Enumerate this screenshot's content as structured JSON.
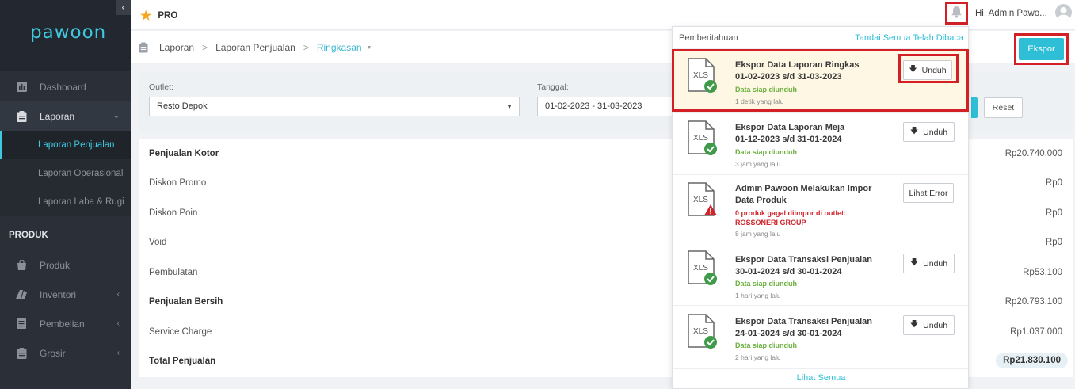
{
  "sidebar": {
    "collapse_glyph": "‹",
    "logo": "pawoon",
    "items": [
      {
        "label": "Dashboard",
        "icon": "bar-chart-icon"
      },
      {
        "label": "Laporan",
        "icon": "clipboard-icon"
      }
    ],
    "sub_items": [
      {
        "label": "Laporan Penjualan",
        "active": true
      },
      {
        "label": "Laporan Operasional"
      },
      {
        "label": "Laporan Laba & Rugi"
      }
    ],
    "section": "PRODUK",
    "product_items": [
      {
        "label": "Produk",
        "icon": "bag-icon"
      },
      {
        "label": "Inventori",
        "icon": "inventory-icon"
      },
      {
        "label": "Pembelian",
        "icon": "document-icon"
      },
      {
        "label": "Grosir",
        "icon": "clipboard-icon"
      }
    ]
  },
  "topbar": {
    "plan": "PRO",
    "greeting": "Hi, Admin Pawo..."
  },
  "breadcrumb": {
    "items": [
      "Laporan",
      "Laporan Penjualan",
      "Ringkasan"
    ],
    "separator": ">"
  },
  "export_label": "Ekspor",
  "filters": {
    "outlet_label": "Outlet:",
    "outlet_value": "Resto Depok",
    "date_label": "Tanggal:",
    "date_value": "01-02-2023 - 31-03-2023",
    "reset_label": "Reset"
  },
  "summary": [
    {
      "label": "Penjualan Kotor",
      "value": "Rp20.740.000",
      "bold": true
    },
    {
      "label": "Diskon Promo",
      "value": "Rp0"
    },
    {
      "label": "Diskon Poin",
      "value": "Rp0"
    },
    {
      "label": "Void",
      "value": "Rp0"
    },
    {
      "label": "Pembulatan",
      "value": "Rp53.100"
    },
    {
      "label": "Penjualan Bersih",
      "value": "Rp20.793.100",
      "bold": true
    },
    {
      "label": "Service Charge",
      "value": "Rp1.037.000"
    },
    {
      "label": "Total Penjualan",
      "value": "Rp21.830.100",
      "bold": true
    }
  ],
  "notifications": {
    "title": "Pemberitahuan",
    "mark_all": "Tandai Semua Telah Dibaca",
    "see_all": "Lihat Semua",
    "file_label": "XLS",
    "items": [
      {
        "title_1": "Ekspor Data Laporan Ringkas",
        "title_2": "01-02-2023 s/d 31-03-2023",
        "status": "Data siap diunduh",
        "time": "1 detik yang lalu",
        "button": "Unduh",
        "kind": "success"
      },
      {
        "title_1": "Ekspor Data Laporan Meja",
        "title_2": "01-12-2023 s/d 31-01-2024",
        "status": "Data siap diunduh",
        "time": "3 jam yang lalu",
        "button": "Unduh",
        "kind": "success"
      },
      {
        "title_1": "Admin Pawoon Melakukan Impor",
        "title_2": "Data Produk",
        "status_1": "0 produk gagal diimpor di outlet:",
        "status_2": "ROSSONERI GROUP",
        "time": "8 jam yang lalu",
        "button": "Lihat Error",
        "kind": "error"
      },
      {
        "title_1": "Ekspor Data Transaksi Penjualan",
        "title_2": "30-01-2024 s/d 30-01-2024",
        "status": "Data siap diunduh",
        "time": "1 hari yang lalu",
        "button": "Unduh",
        "kind": "success"
      },
      {
        "title_1": "Ekspor Data Transaksi Penjualan",
        "title_2": "24-01-2024 s/d 30-01-2024",
        "status": "Data siap diunduh",
        "time": "2 hari yang lalu",
        "button": "Unduh",
        "kind": "success"
      }
    ]
  },
  "colors": {
    "accent": "#2ebfd6",
    "highlight": "#d32027",
    "sidebar": "#2b3038",
    "success": "#3f9b4a"
  }
}
